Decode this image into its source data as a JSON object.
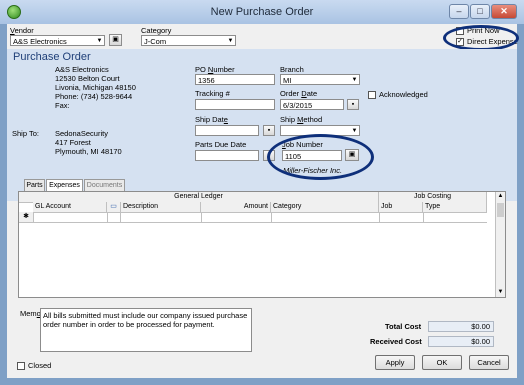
{
  "window": {
    "title": "New Purchase Order"
  },
  "vendor": {
    "label": "Vendor",
    "value": "A&S Electronics"
  },
  "category": {
    "label": "Category",
    "value": "J-Com"
  },
  "options": {
    "print_now": "Print Now",
    "direct_expense": "Direct Expense",
    "direct_expense_checked": "✓"
  },
  "po": {
    "heading": "Purchase Order"
  },
  "vendor_address": {
    "line1": "A&S Electronics",
    "line2": "12530 Belton Court",
    "line3": "Livonia, Michigan  48150",
    "line4": "Phone: (734) 528-9644",
    "line5": "Fax:"
  },
  "ship_to": {
    "label": "Ship To:",
    "line1": "SedonaSecurity",
    "line2": "417 Forest",
    "line3": "Plymouth, MI  48170"
  },
  "fields": {
    "po_number_label": "PO Number",
    "po_number": "1356",
    "branch_label": "Branch",
    "branch": "MI",
    "tracking_label": "Tracking #",
    "tracking": "",
    "order_date_label": "Order Date",
    "order_date": "6/3/2015",
    "acknowledged_label": "Acknowledged",
    "ship_date_label": "Ship Date",
    "ship_date": "",
    "ship_method_label": "Ship Method",
    "ship_method": "",
    "parts_due_label": "Parts Due Date",
    "parts_due": "",
    "job_number_label": "Job Number",
    "job_number": "1105",
    "job_customer": "Miller-Fischer Inc."
  },
  "tabs": [
    "Parts",
    "Expenses",
    "Documents"
  ],
  "grid": {
    "group_gl": "General Ledger",
    "group_job": "Job Costing",
    "columns": [
      "GL Account",
      "Description",
      "Amount",
      "Category",
      "Job",
      "Type"
    ],
    "new_row_marker": "✱"
  },
  "memo": {
    "label": "Memo",
    "text": "All bills submitted must include our company issued purchase order number in order to be processed for payment."
  },
  "totals": {
    "total_label": "Total Cost",
    "total": "$0.00",
    "received_label": "Received Cost",
    "received": "$0.00"
  },
  "footer": {
    "closed_label": "Closed",
    "apply": "Apply",
    "ok": "OK",
    "cancel": "Cancel"
  }
}
